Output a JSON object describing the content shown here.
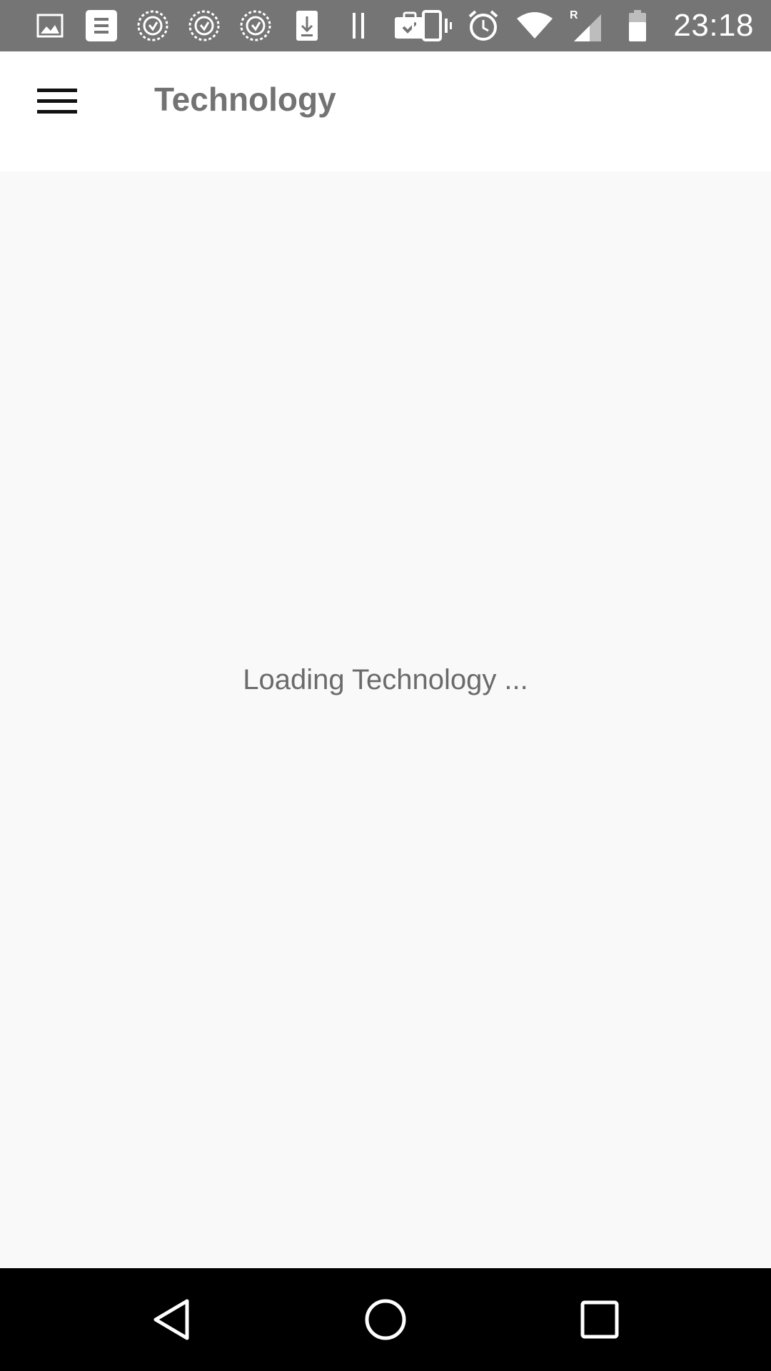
{
  "status_bar": {
    "time": "23:18",
    "left_icons": [
      "gallery-icon",
      "document-icon",
      "app-badge-icon",
      "app-badge-icon",
      "app-badge-icon",
      "download-icon",
      "pause-icon",
      "clipboard-check-icon"
    ],
    "right_icons": [
      "vibrate-icon",
      "alarm-icon",
      "wifi-icon",
      "signal-roaming-icon",
      "battery-icon"
    ],
    "roaming_label": "R",
    "background": "#757575"
  },
  "app_bar": {
    "title": "Technology",
    "menu_icon": "hamburger-menu-icon"
  },
  "main": {
    "loading_text": "Loading Technology ..."
  },
  "nav_bar": {
    "back_icon": "back-icon",
    "home_icon": "home-icon",
    "recents_icon": "recents-icon"
  }
}
